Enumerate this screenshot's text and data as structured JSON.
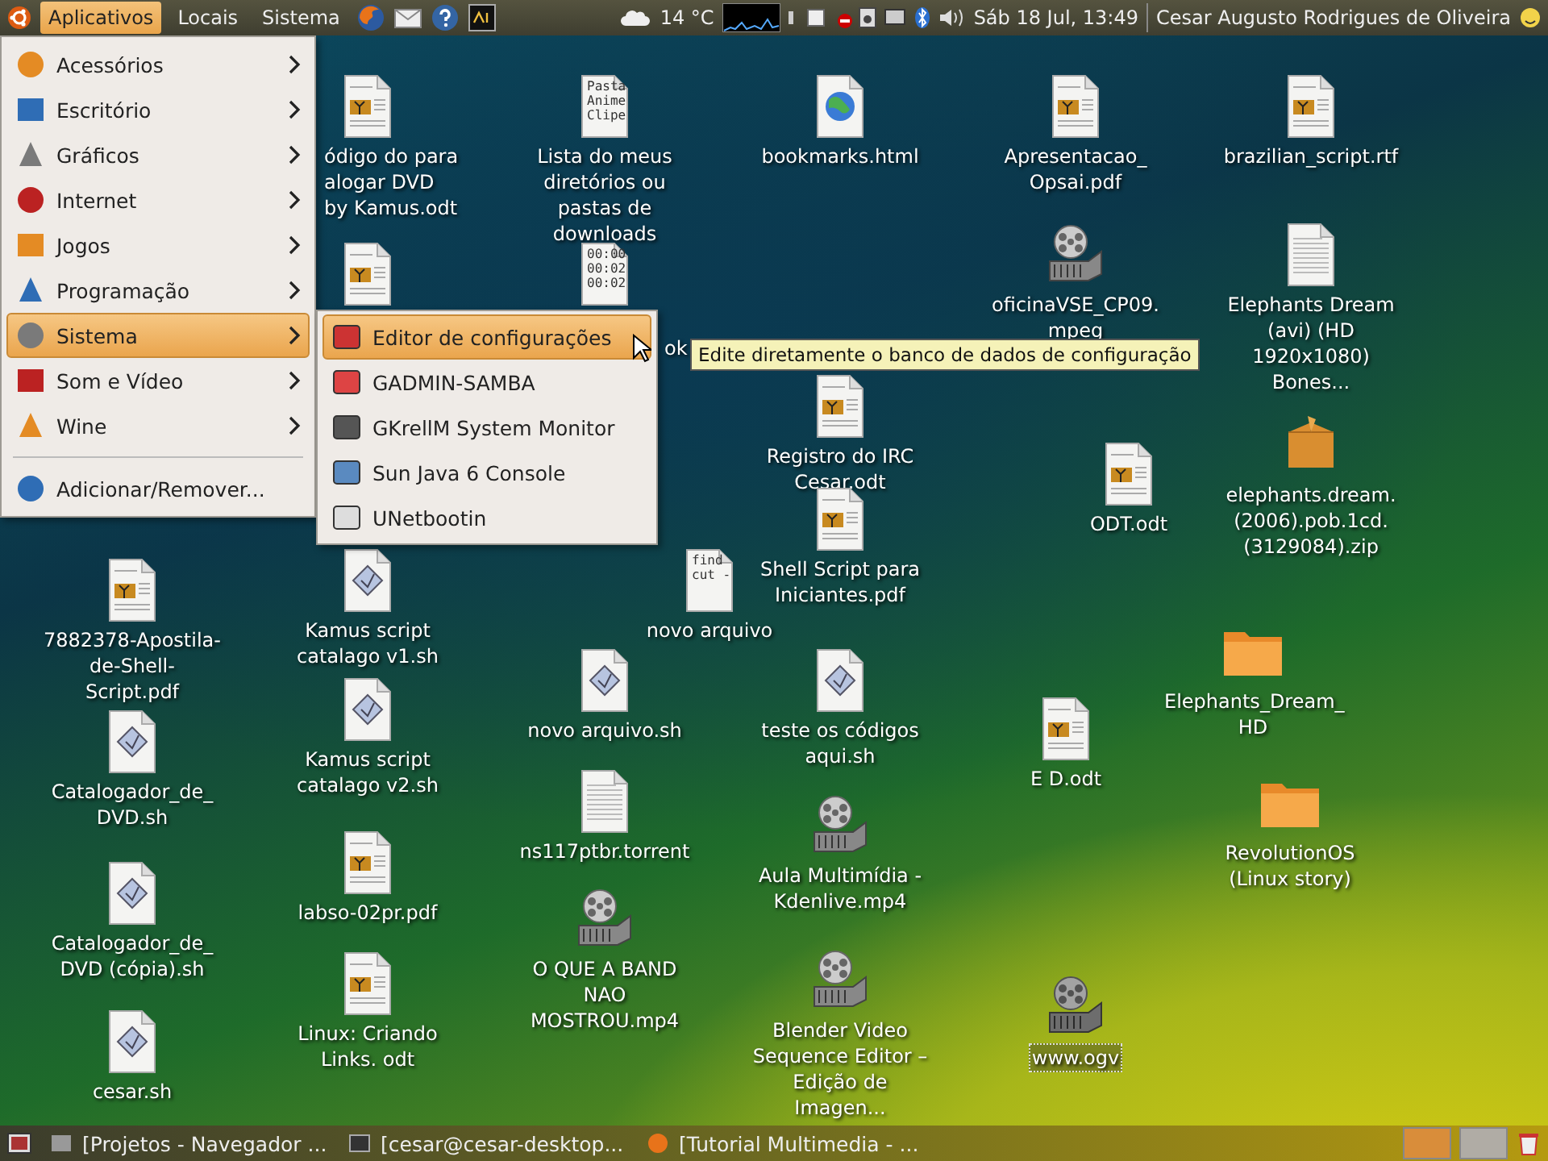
{
  "top_panel": {
    "menus": [
      {
        "label": "Aplicativos",
        "selected": true
      },
      {
        "label": "Locais",
        "selected": false
      },
      {
        "label": "Sistema",
        "selected": false
      }
    ],
    "weather": "14 °C",
    "clock": "Sáb 18 Jul, 13:49",
    "user": "Cesar Augusto Rodrigues de Oliveira"
  },
  "applications_menu": {
    "items": [
      {
        "label": "Acessórios",
        "kind": "submenu",
        "selected": false
      },
      {
        "label": "Escritório",
        "kind": "submenu",
        "selected": false
      },
      {
        "label": "Gráficos",
        "kind": "submenu",
        "selected": false
      },
      {
        "label": "Internet",
        "kind": "submenu",
        "selected": false
      },
      {
        "label": "Jogos",
        "kind": "submenu",
        "selected": false
      },
      {
        "label": "Programação",
        "kind": "submenu",
        "selected": false
      },
      {
        "label": "Sistema",
        "kind": "submenu",
        "selected": true
      },
      {
        "label": "Som e Vídeo",
        "kind": "submenu",
        "selected": false
      },
      {
        "label": "Wine",
        "kind": "submenu",
        "selected": false
      },
      {
        "label": "Adicionar/Remover...",
        "kind": "item",
        "selected": false
      }
    ]
  },
  "system_submenu": {
    "items": [
      {
        "label": "Editor de configurações",
        "selected": true
      },
      {
        "label": "GADMIN-SAMBA",
        "selected": false
      },
      {
        "label": "GKrellM System Monitor",
        "selected": false
      },
      {
        "label": "Sun Java 6 Console",
        "selected": false
      },
      {
        "label": "UNetbootin",
        "selected": false
      }
    ]
  },
  "tooltip": "Edite diretamente o banco de dados de configuração",
  "desktop_icons": [
    {
      "kind": "document",
      "label": "ódigo do para alogar DVD by Kamus.odt",
      "selected": false
    },
    {
      "kind": "listing",
      "preview": [
        "Pasta",
        "Anime",
        "Clipe"
      ],
      "label": "Lista do meus diretórios ou pastas de downloads",
      "selected": false
    },
    {
      "kind": "web",
      "label": "bookmarks.html",
      "selected": false
    },
    {
      "kind": "document",
      "label": "Apresentacao_ Opsai.pdf",
      "selected": false
    },
    {
      "kind": "document",
      "label": "brazilian_script.rtf",
      "selected": false
    },
    {
      "kind": "document",
      "selected": false
    },
    {
      "kind": "listing",
      "preview": [
        "00:00",
        "00:02",
        "00:02"
      ],
      "label": "ok",
      "selected": false
    },
    {
      "kind": "video",
      "label": "oficinaVSE_CP09. mpeg",
      "selected": false
    },
    {
      "kind": "text",
      "label": "Elephants Dream (avi) (HD 1920x1080) Bones...",
      "selected": false
    },
    {
      "kind": "document",
      "label": "Registro do IRC Cesar.odt",
      "selected": false
    },
    {
      "kind": "document",
      "label": "ODT.odt",
      "selected": false
    },
    {
      "kind": "archive",
      "label": "elephants.dream. (2006).pob.1cd. (3129084).zip",
      "selected": false
    },
    {
      "kind": "listing",
      "preview": [
        "find",
        "cut -"
      ],
      "label": "novo arquivo",
      "selected": false
    },
    {
      "kind": "document",
      "label": "Shell Script para Iniciantes.pdf",
      "selected": false
    },
    {
      "kind": "folder",
      "label": "Elephants_Dream_ HD",
      "selected": false
    },
    {
      "kind": "document",
      "label": "7882378-Apostila- de-Shell-Script.pdf",
      "selected": false
    },
    {
      "kind": "script",
      "label": "Kamus script catalago v1.sh",
      "selected": false
    },
    {
      "kind": "script",
      "label": "novo arquivo.sh",
      "selected": false
    },
    {
      "kind": "script",
      "label": "teste os códigos aqui.sh",
      "selected": false
    },
    {
      "kind": "document",
      "label": "E D.odt",
      "selected": false
    },
    {
      "kind": "folder",
      "label": "RevolutionOS (Linux story)",
      "selected": false
    },
    {
      "kind": "script",
      "label": "Catalogador_de_ DVD.sh",
      "selected": false
    },
    {
      "kind": "script",
      "label": "Kamus script catalago v2.sh",
      "selected": false
    },
    {
      "kind": "text",
      "label": "ns117ptbr.torrent",
      "selected": false
    },
    {
      "kind": "video",
      "label": "Aula Multimídia - Kdenlive.mp4",
      "selected": false
    },
    {
      "kind": "script",
      "label": "Catalogador_de_ DVD (cópia).sh",
      "selected": false
    },
    {
      "kind": "document",
      "label": "labso-02pr.pdf",
      "selected": false
    },
    {
      "kind": "video",
      "label": "O QUE A BAND NAO MOSTROU.mp4",
      "selected": false
    },
    {
      "kind": "document",
      "label": "Linux: Criando Links. odt",
      "selected": false
    },
    {
      "kind": "video",
      "label": "Blender Video Sequence Editor – Edição de Imagen...",
      "selected": false
    },
    {
      "kind": "video",
      "label": "www.ogv",
      "selected": true
    },
    {
      "kind": "script",
      "label": "cesar.sh",
      "selected": false
    }
  ],
  "taskbar": {
    "tasks": [
      {
        "label": "[Projetos - Navegador ...",
        "kind": "folder"
      },
      {
        "label": "[cesar@cesar-desktop...",
        "kind": "terminal"
      },
      {
        "label": "[Tutorial Multimedia - ...",
        "kind": "browser"
      }
    ],
    "workspaces": [
      {
        "selected": true
      },
      {
        "selected": false
      }
    ]
  }
}
